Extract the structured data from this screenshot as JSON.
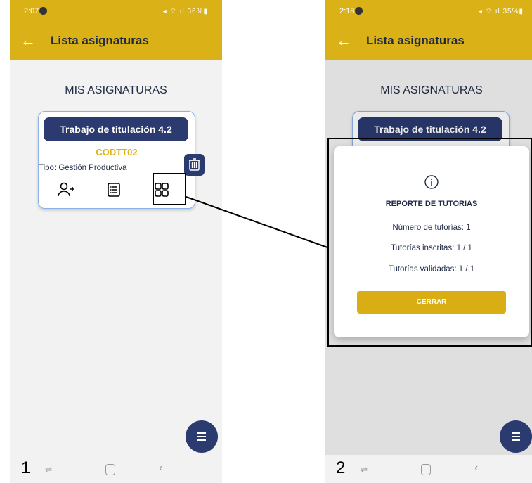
{
  "screens": [
    {
      "status_time": "2:07",
      "status_icons": "◂ ⌔ ıl 36%▮",
      "app_title": "Lista asignaturas",
      "heading": "MIS ASIGNATURAS",
      "card": {
        "title": "Trabajo de titulación 4.2",
        "code": "CODTT02",
        "type": "Tipo: Gestión Productiva"
      },
      "step_number": "1"
    },
    {
      "status_time": "2:18",
      "status_icons": "◂ ⌔ ıl 35%▮",
      "app_title": "Lista asignaturas",
      "heading": "MIS ASIGNATURAS",
      "card": {
        "title": "Trabajo de titulación 4.2"
      },
      "dialog": {
        "title": "REPORTE DE TUTORIAS",
        "lines": [
          "Número de tutorías: 1",
          "Tutorías inscritas: 1 / 1",
          "Tutorías validadas: 1 / 1"
        ],
        "close_label": "CERRAR"
      },
      "step_number": "2"
    }
  ],
  "nav": {
    "recent": "⇌",
    "back": "‹"
  },
  "colors": {
    "brand_yellow": "#dbb118",
    "navy": "#2b3a6f",
    "text": "#1f2b44"
  },
  "icons": [
    "back-arrow-icon",
    "add-user-icon",
    "list-icon",
    "grid-icon",
    "trash-icon",
    "menu-icon",
    "info-icon"
  ]
}
